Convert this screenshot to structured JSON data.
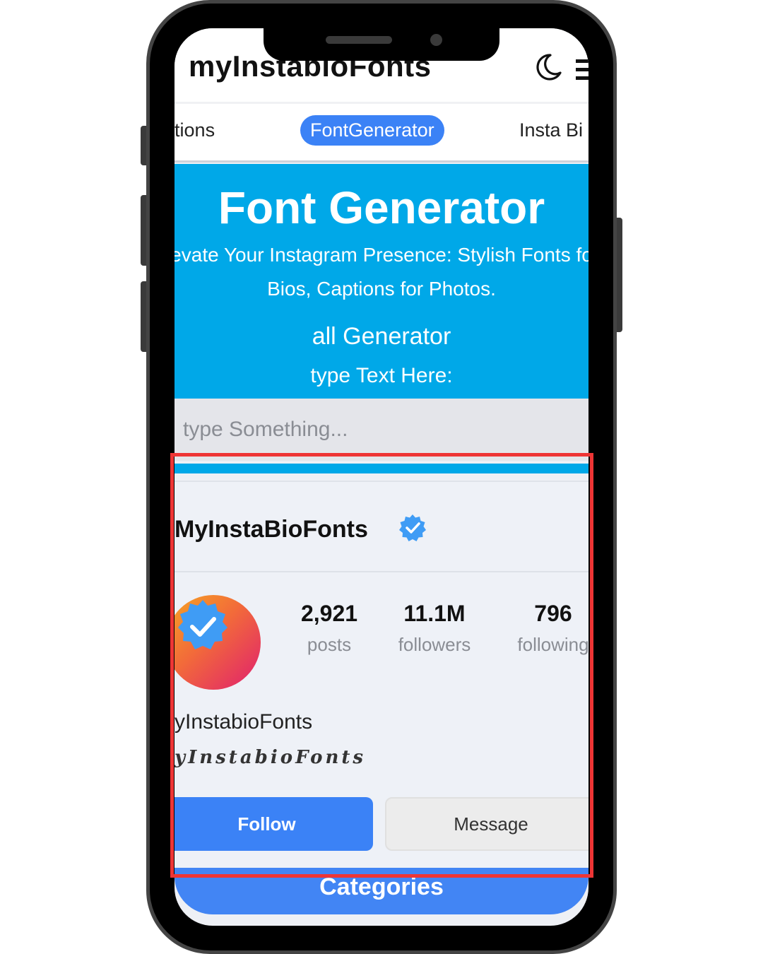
{
  "header": {
    "site_title": "myInstabioFonts",
    "icons": [
      "moon-icon",
      "menu-icon"
    ]
  },
  "tabs": [
    {
      "label": "aptions",
      "active": false
    },
    {
      "label": "FontGenerator",
      "active": true
    },
    {
      "label": "Insta Bi",
      "active": false
    }
  ],
  "hero": {
    "title": "Font Generator",
    "subtitle_line1": "evate Your Instagram Presence: Stylish Fonts fo",
    "subtitle_line2": "Bios, Captions for Photos.",
    "generator_label": "all Generator",
    "type_label": "type Text Here:"
  },
  "input": {
    "value": "",
    "placeholder": "type Something..."
  },
  "profile": {
    "username": "MyInstaBioFonts",
    "verified_icon": "verified-badge-icon",
    "stats": [
      {
        "value": "2,921",
        "label": "posts"
      },
      {
        "value": "11.1M",
        "label": "followers"
      },
      {
        "value": "796",
        "label": "following"
      }
    ],
    "display_name": "yInstabioFonts",
    "fancy_name": "yInstabioFonts",
    "follow_label": "Follow",
    "message_label": "Message"
  },
  "categories": {
    "label": "Categories"
  },
  "colors": {
    "accent_blue": "#3b82f6",
    "hero_blue": "#00a8e8",
    "highlight_red": "#ee3535"
  }
}
